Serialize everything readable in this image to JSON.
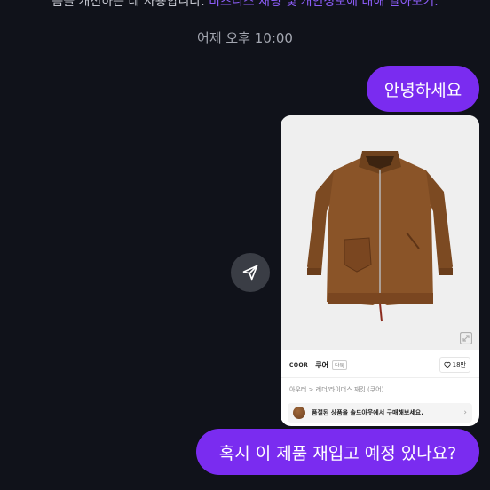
{
  "chat": {
    "top_notice_text": "음을 개선하는 데 사용합니다.",
    "top_notice_link": "비즈니스 채팅 및 개인정보에 대해 알아보기.",
    "timestamp": "어제 오후 10:00",
    "messages": [
      {
        "text": "안녕하세요",
        "from": "me"
      },
      {
        "text": "혹시 이 제품 재입고 예정 있나요?",
        "from": "me"
      }
    ]
  },
  "product_card": {
    "brand_logo": "COOR",
    "brand_name": "쿠어",
    "brand_tag": "단독",
    "likes": "18만",
    "breadcrumb": "아우터 > 레더/라이더스 재킷 (쿠어)",
    "notice": "품절된 상품을 솔드아웃에서 구매해보세요."
  },
  "colors": {
    "background": "#10121a",
    "bubble": "#7a2cf0",
    "link": "#8b5cf6"
  }
}
